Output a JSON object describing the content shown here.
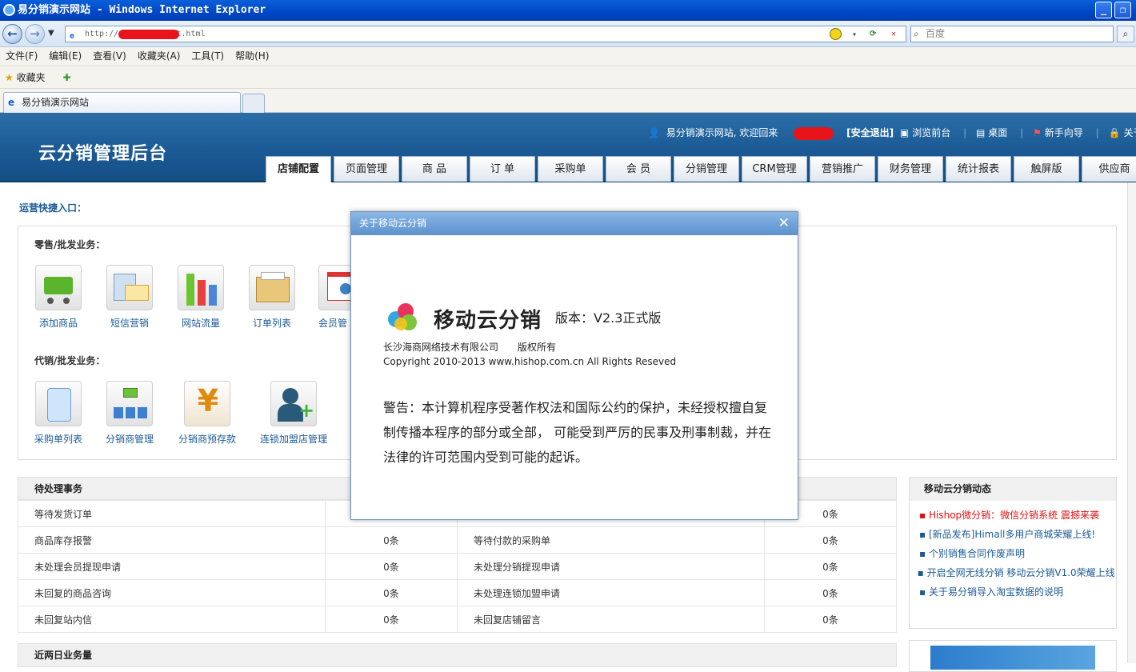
{
  "browser": {
    "title": "易分销演示网站 - Windows Internet Explorer",
    "url": "http://                    dmin/default.html",
    "search_placeholder": "百度",
    "menu": [
      "文件(F)",
      "编辑(E)",
      "查看(V)",
      "收藏夹(A)",
      "工具(T)",
      "帮助(H)"
    ],
    "favorites_label": "收藏夹",
    "tab_title": "易分销演示网站"
  },
  "header": {
    "logo": "云分销管理后台",
    "welcome": "易分销演示网站, 欢迎回来",
    "logout": "[安全退出]",
    "links": [
      "浏览前台",
      "桌面",
      "新手向导",
      "关于"
    ],
    "nav_tabs": [
      "店铺配置",
      "页面管理",
      "商 品",
      "订 单",
      "采购单",
      "会 员",
      "分销管理",
      "CRM管理",
      "营销推广",
      "财务管理",
      "统计报表",
      "触屏版",
      "供应商"
    ]
  },
  "quick": {
    "title": "运营快捷入口：",
    "retail_label": "零售/批发业务：",
    "retail_items": [
      "添加商品",
      "短信营销",
      "网站流量",
      "订单列表",
      "会员管"
    ],
    "agent_label": "代销/批发业务：",
    "agent_items": [
      "采购单列表",
      "分销商管理",
      "分销商预存款",
      "连锁加盟店管理"
    ]
  },
  "tasks": {
    "title": "待处理事务",
    "rows": [
      {
        "l": "等待发货订单",
        "lv": "",
        "r": "",
        "rv": "0条"
      },
      {
        "l": "商品库存报警",
        "lv": "0条",
        "r": "等待付款的采购单",
        "rv": "0条"
      },
      {
        "l": "未处理会员提现申请",
        "lv": "0条",
        "r": "未处理分销提现申请",
        "rv": "0条"
      },
      {
        "l": "未回复的商品咨询",
        "lv": "0条",
        "r": "未处理连锁加盟申请",
        "rv": "0条"
      },
      {
        "l": "未回复站内信",
        "lv": "0条",
        "r": "未回复店铺留言",
        "rv": "0条"
      }
    ]
  },
  "business": {
    "title": "近两日业务量"
  },
  "news": {
    "title": "移动云分销动态",
    "items": [
      "Hishop微分销：微信分销系统 震撼来袭",
      "[新品发布]Himall多用户商城荣耀上线!",
      "个别销售合同作废声明",
      "开启全网无线分销 移动云分销V1.0荣耀上线",
      "关于易分销导入淘宝数据的说明"
    ]
  },
  "dialog": {
    "title": "关于移动云分销",
    "product": "移动云分销",
    "version": "版本：V2.3正式版",
    "company": "长沙海商网络技术有限公司",
    "rights": "版权所有",
    "copyright": "Copyright 2010-2013 www.hishop.com.cn All Rights Reseved",
    "warning": "警告：本计算机程序受著作权法和国际公约的保护，未经授权擅自复制传播本程序的部分或全部， 可能受到严厉的民事及刑事制裁，并在法律的许可范围内受到可能的起诉。"
  },
  "colors": {
    "header_blue": "#1b5a95",
    "link_blue": "#1b5a95",
    "hot_red": "#dd1111"
  }
}
